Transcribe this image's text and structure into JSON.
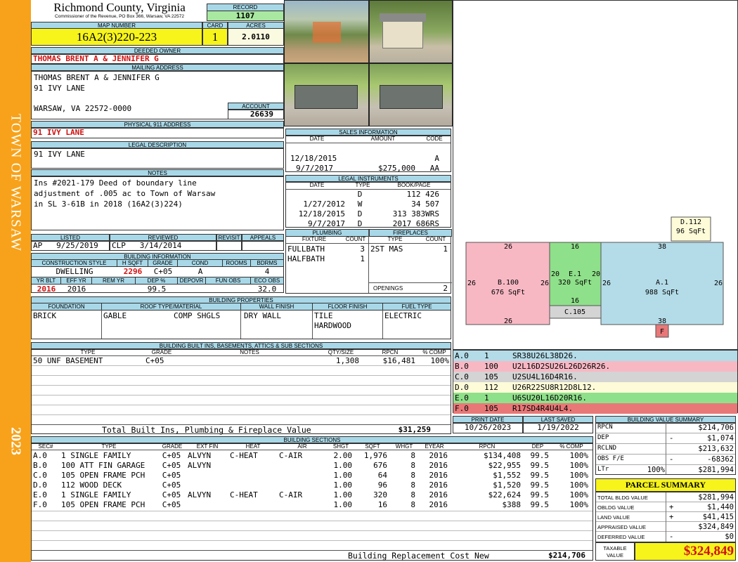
{
  "header": {
    "county": "Richmond County, Virginia",
    "commissioner": "Commissioner of the Revenue, PO Box 366, Warsaw, VA 22572",
    "record_label": "RECORD",
    "record": "1107",
    "map_label": "MAP NUMBER",
    "map_number": "16A2(3)220-223",
    "card_label": "CARD",
    "card": "1",
    "acres_label": "ACRES",
    "acres": "2.0110"
  },
  "sidebar": {
    "town": "TOWN OF WARSAW",
    "year": "2023"
  },
  "owner": {
    "label": "DEEDED OWNER",
    "name": "THOMAS BRENT A & JENNIFER G",
    "mail_label": "MAILING ADDRESS",
    "mail1": "THOMAS BRENT A & JENNIFER G",
    "mail2": "91 IVY LANE",
    "mail3": "WARSAW, VA 22572-0000",
    "account_label": "ACCOUNT",
    "account": "26639",
    "phys_label": "PHYSICAL 911 ADDRESS",
    "phys": "91 IVY LANE"
  },
  "legal": {
    "label": "LEGAL DESCRIPTION",
    "text": "91 IVY LANE"
  },
  "notes": {
    "label": "NOTES",
    "l1": "Ins #2021-179 Deed of boundary line",
    "l2": "adjustment of .005 ac to Town of Warsaw",
    "l3": "in SL 3-61B in 2018 (16A2(3)224)"
  },
  "sales": {
    "label": "SALES INFORMATION",
    "h_date": "DATE",
    "h_amount": "AMOUNT",
    "h_code": "CODE",
    "rows": [
      {
        "date": "12/18/2015",
        "amount": "",
        "code": "A"
      },
      {
        "date": "9/7/2017",
        "amount": "$275,000",
        "code": "AA"
      }
    ]
  },
  "instruments": {
    "label": "LEGAL INSTRUMENTS",
    "h_date": "DATE",
    "h_type": "TYPE",
    "h_book": "BOOK/PAGE",
    "rows": [
      {
        "date": "",
        "type": "D",
        "book": "112 426"
      },
      {
        "date": "1/27/2012",
        "type": "W",
        "book": "34 507"
      },
      {
        "date": "12/18/2015",
        "type": "D",
        "book": "313 383WRS"
      },
      {
        "date": "9/7/2017",
        "type": "D",
        "book": "2017 686RS"
      }
    ]
  },
  "review": {
    "h_listed": "LISTED",
    "h_reviewed": "REVIEWED",
    "h_revisit": "REVISIT",
    "h_appeals": "APPEALS",
    "listed_by": "AP",
    "listed": "9/25/2019",
    "reviewed_by": "CLP",
    "reviewed": "3/14/2014"
  },
  "bldg_info": {
    "label": "BUILDING INFORMATION",
    "h_style": "CONSTRUCTION STYLE",
    "h_hsqft": "H SQFT",
    "h_grade": "GRADE",
    "h_cond": "COND",
    "h_rooms": "ROOMS",
    "h_bdrms": "BDRMS",
    "style": "DWELLING",
    "hsqft": "2296",
    "grade": "C+05",
    "cond": "A",
    "rooms": "",
    "bdrms": "4",
    "h_yrblt": "YR BLT",
    "h_effyr": "EFF YR",
    "h_remyr": "REM YR",
    "h_dep": "DEP %",
    "h_depovr": "DEPOVR",
    "h_funobs": "FUN OBS",
    "h_ecoobs": "ECO OBS",
    "yrblt": "2016",
    "effyr": "2016",
    "dep": "99.5",
    "ecoobs": "32.0"
  },
  "plumbing": {
    "label": "PLUMBING",
    "h_fixture": "FIXTURE",
    "h_count": "COUNT",
    "rows": [
      {
        "f": "FULLBATH",
        "c": "3"
      },
      {
        "f": "HALFBATH",
        "c": "1"
      }
    ]
  },
  "fireplaces": {
    "label": "FIREPLACES",
    "h_type": "TYPE",
    "h_count": "COUNT",
    "rows": [
      {
        "t": "2ST MAS",
        "c": "1"
      }
    ],
    "openings_label": "OPENINGS",
    "openings": "2"
  },
  "props": {
    "label": "BUILDING PROPERTIES",
    "h_found": "FOUNDATION",
    "h_roof": "ROOF TYPE/MATERIAL",
    "h_wall": "WALL FINISH",
    "h_floor": "FLOOR FINISH",
    "h_fuel": "FUEL TYPE",
    "found": "BRICK",
    "roof1": "GABLE",
    "roof2": "COMP SHGLS",
    "wall": "DRY WALL",
    "floor1": "TILE",
    "floor2": "HARDWOOD",
    "fuel": "ELECTRIC"
  },
  "builtins": {
    "label": "BUILDING BUILT INS, BASEMENTS, ATTICS & SUB SECTIONS",
    "h_type": "TYPE",
    "h_grade": "GRADE",
    "h_notes": "NOTES",
    "h_qty": "QTY/SIZE",
    "h_rpcn": "RPCN",
    "h_comp": "% COMP",
    "row": {
      "type": "50 UNF BASEMENT",
      "grade": "C+05",
      "qty": "1,308",
      "rpcn": "$16,481",
      "comp": "100%"
    },
    "total_label": "Total Built Ins, Plumbing & Fireplace Value",
    "total": "$31,259"
  },
  "print": {
    "h_print": "PRINT DATE",
    "h_saved": "LAST SAVED",
    "print": "10/26/2023",
    "saved": "1/19/2022"
  },
  "sketch": {
    "D": {
      "label": "D.112",
      "area": "96 SqFt"
    },
    "B": {
      "label": "B.100",
      "area": "676 SqFt"
    },
    "E": {
      "label": "E.1",
      "area": "320 SqFt"
    },
    "A": {
      "label": "A.1",
      "area": "988 SqFt"
    },
    "C": {
      "label": "C.105"
    },
    "F": {
      "label": "F"
    },
    "dims": {
      "b_top": "26",
      "b_left": "26",
      "b_right": "26",
      "b_bot": "26",
      "e_top": "16",
      "e_left": "20",
      "e_right": "20",
      "e_bot": "16",
      "a_top": "38",
      "a_left": "26",
      "a_right": "26",
      "a_bot": "38"
    },
    "colors": {
      "A": "#b4dce8",
      "B": "#f7b8c4",
      "C": "#d4d4d4",
      "D": "#fdfbd8",
      "E": "#8fe08a",
      "F": "#e87878"
    }
  },
  "codes": [
    {
      "id": "A.0",
      "n": "1",
      "c": "SR38U26L38D26."
    },
    {
      "id": "B.0",
      "n": "100",
      "c": "U2L16D2SU26L26D26R26."
    },
    {
      "id": "C.0",
      "n": "105",
      "c": "U2SU4L16D4R16."
    },
    {
      "id": "D.0",
      "n": "112",
      "c": "U26R22SU8R12D8L12."
    },
    {
      "id": "E.0",
      "n": "1",
      "c": "U6SU20L16D20R16."
    },
    {
      "id": "F.0",
      "n": "105",
      "c": "R17SD4R4U4L4."
    }
  ],
  "value_summary": {
    "label": "BUILDING VALUE SUMMARY",
    "rpcn_l": "RPCN",
    "rpcn": "$214,706",
    "dep_l": "DEP",
    "dep_s": "-",
    "dep": "$1,074",
    "rclnd_l": "RCLND",
    "rclnd": "$213,632",
    "obs_l": "OBS F/E",
    "obs_s": "-",
    "obs": "-68362",
    "ltr_l": "LTr",
    "ltr_pct": "100%",
    "ltr": "$281,994"
  },
  "parcel": {
    "label": "PARCEL SUMMARY",
    "tbv_l": "TOTAL BLDG VALUE",
    "tbv": "$281,994",
    "ob_l": "OBLDG VALUE",
    "ob_s": "+",
    "ob": "$1,440",
    "land_l": "LAND VALUE",
    "land_s": "+",
    "land": "$41,415",
    "appr_l": "APPRAISED VALUE",
    "appr": "$324,849",
    "def_l": "DEFERRED VALUE",
    "def_s": "-",
    "def": "$0",
    "tax_l1": "TAXABLE",
    "tax_l2": "VALUE",
    "tax": "$324,849"
  },
  "sections": {
    "label": "BUILDING SECTIONS",
    "headers": [
      "SEC#",
      "TYPE",
      "GRADE",
      "EXT FIN",
      "HEAT",
      "AIR",
      "SHGT",
      "SQFT",
      "WHGT",
      "EYEAR",
      "RPCN",
      "DEP",
      "% COMP"
    ],
    "rows": [
      [
        "A.0",
        "1 SINGLE FAMILY",
        "C+05",
        "ALVYN",
        "C-HEAT",
        "C-AIR",
        "2.00",
        "1,976",
        "8",
        "2016",
        "$134,408",
        "99.5",
        "100%"
      ],
      [
        "B.0",
        "100 ATT FIN GARAGE",
        "C+05",
        "ALVYN",
        "",
        "",
        "1.00",
        "676",
        "8",
        "2016",
        "$22,955",
        "99.5",
        "100%"
      ],
      [
        "C.0",
        "105 OPEN FRAME PCH",
        "C+05",
        "",
        "",
        "",
        "1.00",
        "64",
        "8",
        "2016",
        "$1,552",
        "99.5",
        "100%"
      ],
      [
        "D.0",
        "112 WOOD DECK",
        "C+05",
        "",
        "",
        "",
        "1.00",
        "96",
        "8",
        "2016",
        "$1,520",
        "99.5",
        "100%"
      ],
      [
        "E.0",
        "1 SINGLE FAMILY",
        "C+05",
        "ALVYN",
        "C-HEAT",
        "C-AIR",
        "1.00",
        "320",
        "8",
        "2016",
        "$22,624",
        "99.5",
        "100%"
      ],
      [
        "F.0",
        "105 OPEN FRAME PCH",
        "C+05",
        "",
        "",
        "",
        "1.00",
        "16",
        "8",
        "2016",
        "$388",
        "99.5",
        "100%"
      ]
    ],
    "total_label": "Building Replacement Cost New",
    "total": "$214,706"
  }
}
